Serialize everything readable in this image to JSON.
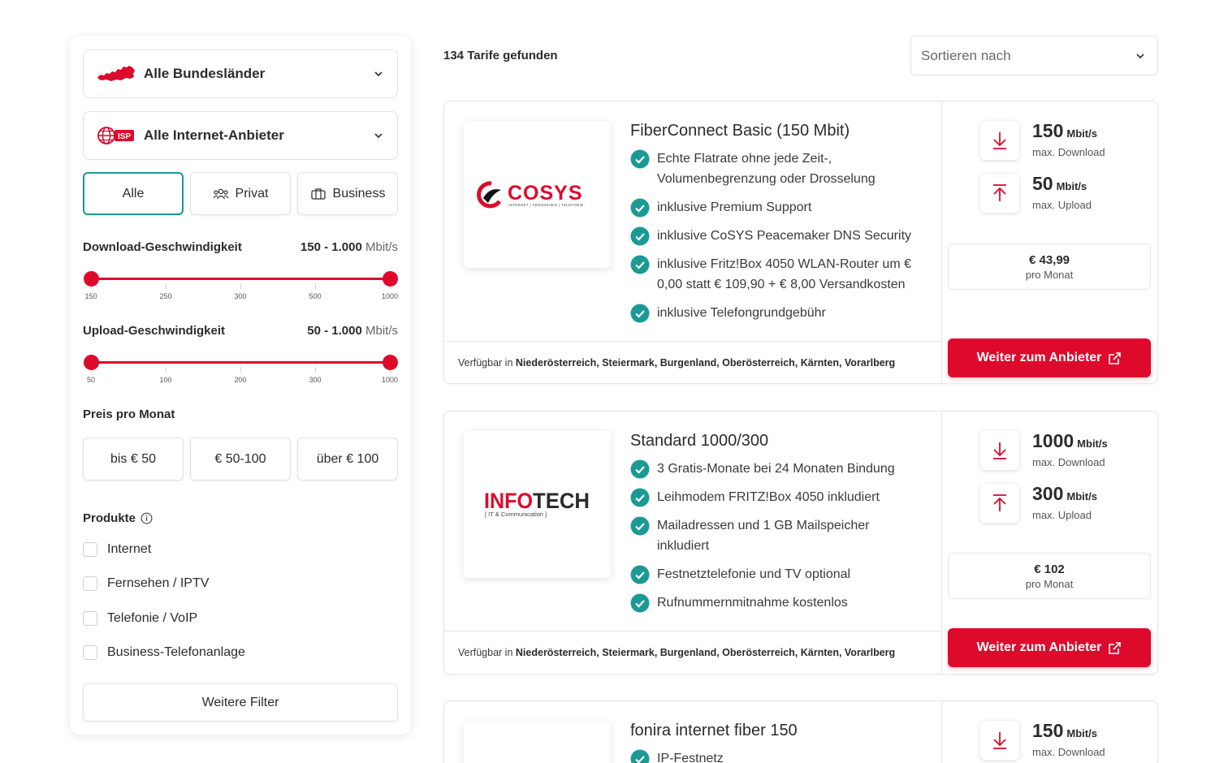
{
  "sidebar": {
    "region_dropdown": {
      "label": "Alle Bundesländer",
      "icon": "austria-map-icon"
    },
    "provider_dropdown": {
      "label": "Alle Internet-Anbieter",
      "icon": "isp-globe-icon",
      "badge": "ISP"
    },
    "customer_type": [
      {
        "label": "Alle",
        "icon": "",
        "active": true
      },
      {
        "label": "Privat",
        "icon": "users-icon",
        "active": false
      },
      {
        "label": "Business",
        "icon": "briefcase-icon",
        "active": false
      }
    ],
    "download": {
      "title": "Download-Geschwindigkeit",
      "range_value": "150 - 1.000",
      "unit": "Mbit/s",
      "ticks": [
        "150",
        "250",
        "300",
        "500",
        "1000"
      ],
      "selected_min_fraction": 0,
      "selected_max_fraction": 1
    },
    "upload": {
      "title": "Upload-Geschwindigkeit",
      "range_value": "50 - 1.000",
      "unit": "Mbit/s",
      "ticks": [
        "50",
        "100",
        "200",
        "300",
        "1000"
      ],
      "selected_min_fraction": 0,
      "selected_max_fraction": 1
    },
    "price": {
      "title": "Preis pro Monat",
      "options": [
        "bis € 50",
        "€ 50-100",
        "über € 100"
      ]
    },
    "products": {
      "title": "Produkte",
      "items": [
        "Internet",
        "Fernsehen / IPTV",
        "Telefonie / VoIP",
        "Business-Telefonanlage"
      ]
    },
    "more_filters_label": "Weitere Filter"
  },
  "results": {
    "count_label": "134 Tarife gefunden",
    "sort_placeholder": "Sortieren nach"
  },
  "tariffs": [
    {
      "provider_logo_text": "COSYS",
      "provider_logo_sub": "INTERNET | FERNSEHEN | TELEFONIE",
      "name": "FiberConnect Basic (150 Mbit)",
      "features": [
        "Echte Flatrate ohne jede Zeit-, Volumenbegrenzung oder Drosselung",
        "inklusive Premium Support",
        "inklusive CoSYS Peacemaker DNS Security",
        "inklusive Fritz!Box 4050 WLAN-Router um € 0,00 statt € 109,90 + € 8,00 Versandkosten",
        "inklusive Telefongrundgebühr"
      ],
      "availability_prefix": "Verfügbar in",
      "availability": "Niederösterreich, Steiermark, Burgenland, Oberösterreich, Kärnten, Vorarlberg",
      "download": "150",
      "download_unit": "Mbit/s",
      "download_label": "max. Download",
      "upload": "50",
      "upload_unit": "Mbit/s",
      "upload_label": "max. Upload",
      "price": "€ 43,99",
      "price_period": "pro Monat",
      "cta": "Weiter zum Anbieter"
    },
    {
      "provider_logo_text": "INFOTECH",
      "provider_logo_sub": "[ IT & Communication ]",
      "name": "Standard 1000/300",
      "features": [
        "3 Gratis-Monate bei 24 Monaten Bindung",
        "Leihmodem FRITZ!Box 4050 inkludiert",
        "Mailadressen und 1 GB Mailspeicher inkludiert",
        "Festnetztelefonie und TV optional",
        "Rufnummernmitnahme kostenlos"
      ],
      "availability_prefix": "Verfügbar in",
      "availability": "Niederösterreich, Steiermark, Burgenland, Oberösterreich, Kärnten, Vorarlberg",
      "download": "1000",
      "download_unit": "Mbit/s",
      "download_label": "max. Download",
      "upload": "300",
      "upload_unit": "Mbit/s",
      "upload_label": "max. Upload",
      "price": "€ 102",
      "price_period": "pro Monat",
      "cta": "Weiter zum Anbieter"
    },
    {
      "name": "fonira internet fiber 150",
      "features": [
        "IP-Festnetz"
      ],
      "download": "150",
      "download_unit": "Mbit/s",
      "download_label": "max. Download"
    }
  ],
  "colors": {
    "accent_red": "#dd0a2c",
    "teal": "#1b9a95",
    "border": "#e1e1e1"
  }
}
